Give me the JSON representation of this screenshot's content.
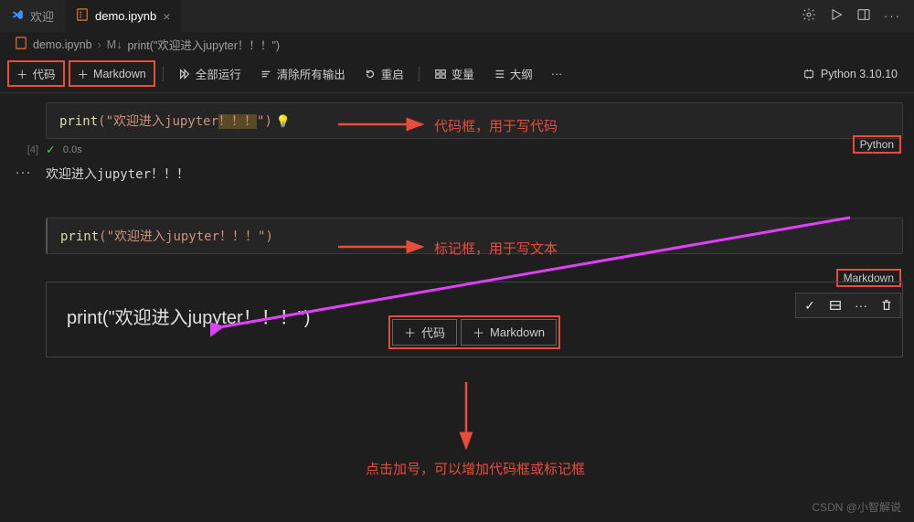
{
  "tabs": {
    "welcome": "欢迎",
    "file": "demo.ipynb"
  },
  "breadcrumbs": {
    "file": "demo.ipynb",
    "symbol": "print(\"欢迎进入jupyter！！！\")"
  },
  "toolbar": {
    "code": "代码",
    "markdown": "Markdown",
    "run_all": "全部运行",
    "clear_output": "清除所有输出",
    "restart": "重启",
    "variables": "变量",
    "outline": "大纲",
    "more": "···"
  },
  "kernel": {
    "label": "Python 3.10.10"
  },
  "cell1": {
    "exec_count": "[4]",
    "fn": "print",
    "str_open": "(\"",
    "str_body": "欢迎进入jupyter",
    "str_hl": "！！！",
    "str_close": "\")",
    "time": "0.0s",
    "lang": "Python"
  },
  "output1": "欢迎进入jupyter！！！",
  "cell2": {
    "fn": "print",
    "body": "(\"欢迎进入jupyter！！！\")",
    "lang": "Markdown"
  },
  "cell3": {
    "rendered": "print(\"欢迎进入jupyter！！！\")"
  },
  "add": {
    "code": "代码",
    "markdown": "Markdown"
  },
  "annotations": {
    "code_box": "代码框，用于写代码",
    "md_box": "标记框，用于写文本",
    "add_hint": "点击加号，可以增加代码框或标记框"
  },
  "watermark": "CSDN @小智解说",
  "icons": {
    "plus": "＋",
    "dots": "···"
  }
}
